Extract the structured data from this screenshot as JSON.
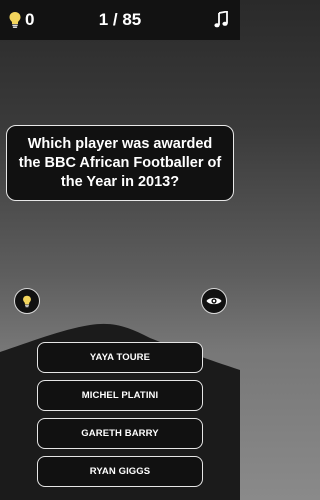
{
  "header": {
    "hints_count": "0",
    "progress": "1 / 85"
  },
  "question": {
    "text": "Which player was awarded the BBC African Footballer of the Year in 2013?"
  },
  "answers": [
    {
      "label": "YAYA TOURE"
    },
    {
      "label": "MICHEL PLATINI"
    },
    {
      "label": "GARETH BARRY"
    },
    {
      "label": "RYAN GIGGS"
    }
  ],
  "icons": {
    "hints": "lightbulb-icon",
    "music": "music-note-icon",
    "hint_button": "lightbulb-icon",
    "reveal_button": "eye-icon"
  },
  "colors": {
    "bulb": "#f2d45c",
    "panel": "#111111",
    "border": "#e8e8e8"
  }
}
